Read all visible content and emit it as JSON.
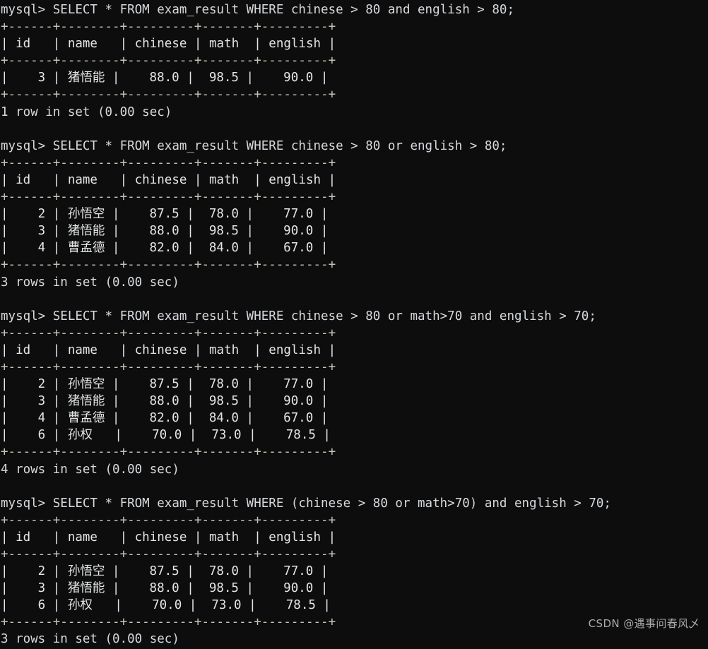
{
  "terminal": {
    "background_color": "#0d0d0d",
    "text_color": "#d6dade",
    "prompt": "mysql>",
    "table_name": "exam_result",
    "columns": [
      "id",
      "name",
      "chinese",
      "math",
      "english"
    ],
    "separator_row": "+------+--------+---------+-------+---------+",
    "header_row": "| id   | name   | chinese | math  | english |"
  },
  "blocks": [
    {
      "query": "mysql> SELECT * FROM exam_result WHERE chinese > 80 and english > 80;",
      "rows": [
        "|    3 | 猪悟能 |    88.0 |  98.5 |    90.0 |"
      ],
      "status": "1 row in set (0.00 sec)",
      "row_data": [
        {
          "id": "3",
          "name": "猪悟能",
          "chinese": "88.0",
          "math": "98.5",
          "english": "90.0"
        }
      ]
    },
    {
      "query": "mysql> SELECT * FROM exam_result WHERE chinese > 80 or english > 80;",
      "rows": [
        "|    2 | 孙悟空 |    87.5 |  78.0 |    77.0 |",
        "|    3 | 猪悟能 |    88.0 |  98.5 |    90.0 |",
        "|    4 | 曹孟德 |    82.0 |  84.0 |    67.0 |"
      ],
      "status": "3 rows in set (0.00 sec)",
      "row_data": [
        {
          "id": "2",
          "name": "孙悟空",
          "chinese": "87.5",
          "math": "78.0",
          "english": "77.0"
        },
        {
          "id": "3",
          "name": "猪悟能",
          "chinese": "88.0",
          "math": "98.5",
          "english": "90.0"
        },
        {
          "id": "4",
          "name": "曹孟德",
          "chinese": "82.0",
          "math": "84.0",
          "english": "67.0"
        }
      ]
    },
    {
      "query": "mysql> SELECT * FROM exam_result WHERE chinese > 80 or math>70 and english > 70;",
      "rows": [
        "|    2 | 孙悟空 |    87.5 |  78.0 |    77.0 |",
        "|    3 | 猪悟能 |    88.0 |  98.5 |    90.0 |",
        "|    4 | 曹孟德 |    82.0 |  84.0 |    67.0 |",
        "|    6 | 孙权   |    70.0 |  73.0 |    78.5 |"
      ],
      "status": "4 rows in set (0.00 sec)",
      "row_data": [
        {
          "id": "2",
          "name": "孙悟空",
          "chinese": "87.5",
          "math": "78.0",
          "english": "77.0"
        },
        {
          "id": "3",
          "name": "猪悟能",
          "chinese": "88.0",
          "math": "98.5",
          "english": "90.0"
        },
        {
          "id": "4",
          "name": "曹孟德",
          "chinese": "82.0",
          "math": "84.0",
          "english": "67.0"
        },
        {
          "id": "6",
          "name": "孙权",
          "chinese": "70.0",
          "math": "73.0",
          "english": "78.5"
        }
      ]
    },
    {
      "query": "mysql> SELECT * FROM exam_result WHERE (chinese > 80 or math>70) and english > 70;",
      "rows": [
        "|    2 | 孙悟空 |    87.5 |  78.0 |    77.0 |",
        "|    3 | 猪悟能 |    88.0 |  98.5 |    90.0 |",
        "|    6 | 孙权   |    70.0 |  73.0 |    78.5 |"
      ],
      "status": "3 rows in set (0.00 sec)",
      "row_data": [
        {
          "id": "2",
          "name": "孙悟空",
          "chinese": "87.5",
          "math": "78.0",
          "english": "77.0"
        },
        {
          "id": "3",
          "name": "猪悟能",
          "chinese": "88.0",
          "math": "98.5",
          "english": "90.0"
        },
        {
          "id": "6",
          "name": "孙权",
          "chinese": "70.0",
          "math": "73.0",
          "english": "78.5"
        }
      ]
    }
  ],
  "watermark": "CSDN @遇事问春风乄"
}
